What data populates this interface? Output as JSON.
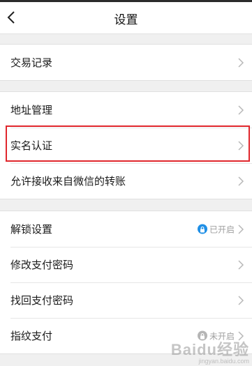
{
  "header": {
    "title": "设置",
    "back_icon": "chevron-left-icon"
  },
  "groups": [
    {
      "items": [
        {
          "label": "交易记录"
        }
      ]
    },
    {
      "items": [
        {
          "label": "地址管理"
        },
        {
          "label": "实名认证",
          "highlighted": true
        },
        {
          "label": "允许接收来自微信的转账"
        }
      ]
    },
    {
      "items": [
        {
          "label": "解锁设置",
          "status": "已开启"
        },
        {
          "label": "修改支付密码"
        },
        {
          "label": "找回支付密码"
        },
        {
          "label": "指纹支付",
          "status": "未开启"
        }
      ]
    }
  ],
  "colors": {
    "accent": "#1f8fe6",
    "highlight_border": "#e0262c",
    "background": "#f0f0f0"
  },
  "watermark": {
    "logo": "Baidu经验",
    "url": "jingyan.baidu.com"
  }
}
